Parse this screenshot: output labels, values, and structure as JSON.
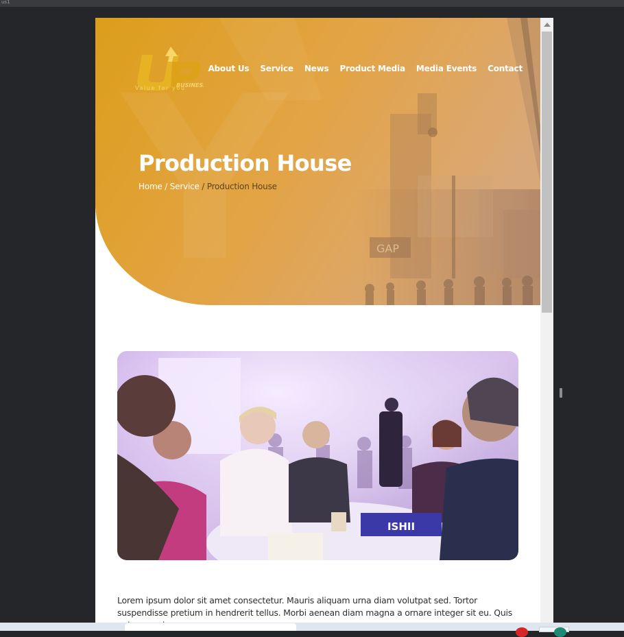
{
  "window": {
    "tab_fragment": "us1"
  },
  "header": {
    "logo": {
      "mark": "UP",
      "badge": "BUSINESS",
      "tagline": "Value for you"
    },
    "nav": [
      "About Us",
      "Service",
      "News",
      "Product Media",
      "Media Events",
      "Contact"
    ]
  },
  "hero": {
    "title": "Production House",
    "breadcrumb": {
      "home": "Home",
      "sep1": " / ",
      "service": "Service",
      "sep2": " / ",
      "current": "Production House"
    },
    "scene_signs": [
      "GAP"
    ]
  },
  "content": {
    "photo_sign": "ISHII",
    "paragraph": "Lorem ipsum dolor sit amet consectetur. Mauris aliquam urna diam volutpat sed. Tortor suspendisse pretium in hendrerit tellus. Morbi aenean diam magna a ornare integer sit eu. Quis enim mauris"
  },
  "colors": {
    "hero_gold": "#dea42a",
    "nav_text": "#ffffff",
    "breadcrumb_current": "#5b4316",
    "page_bg": "#ffffff",
    "desktop_bg": "#25262a"
  }
}
